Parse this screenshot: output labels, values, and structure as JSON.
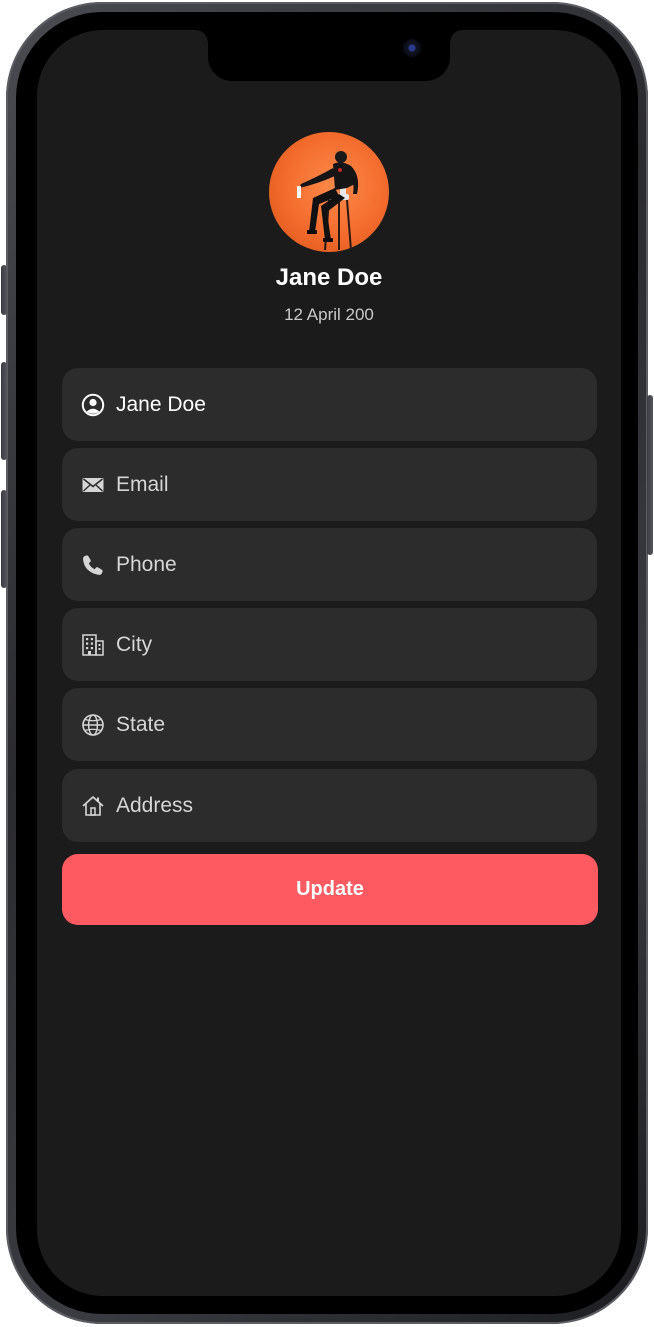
{
  "profile": {
    "name": "Jane Doe",
    "date": "12 April 200"
  },
  "form": {
    "fields": [
      {
        "key": "name",
        "icon": "person-circle-icon",
        "value": "Jane Doe",
        "placeholder": ""
      },
      {
        "key": "email",
        "icon": "envelope-icon",
        "value": "",
        "placeholder": "Email"
      },
      {
        "key": "phone",
        "icon": "phone-icon",
        "value": "",
        "placeholder": "Phone"
      },
      {
        "key": "city",
        "icon": "building-icon",
        "value": "",
        "placeholder": "City"
      },
      {
        "key": "state",
        "icon": "globe-icon",
        "value": "",
        "placeholder": "State"
      },
      {
        "key": "address",
        "icon": "house-icon",
        "value": "",
        "placeholder": "Address"
      }
    ],
    "submit_label": "Update"
  },
  "colors": {
    "background": "#1b1b1b",
    "field_background": "#2c2c2c",
    "accent": "#fe5a62",
    "avatar_background": "#f26b2c"
  }
}
